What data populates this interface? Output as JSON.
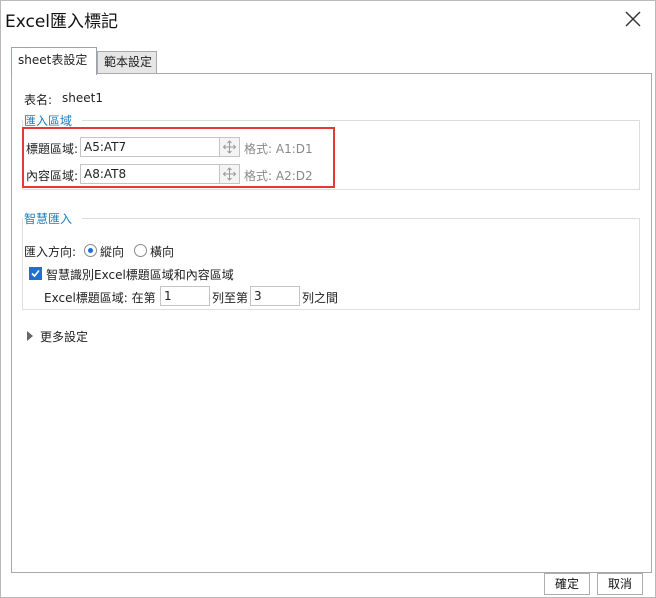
{
  "window": {
    "title": "Excel匯入標記"
  },
  "tabs": [
    {
      "label": "sheet表設定"
    },
    {
      "label": "範本設定"
    }
  ],
  "sheet": {
    "label": "表名:",
    "name": "sheet1"
  },
  "import_area": {
    "section_title": "匯入區域",
    "header": {
      "label": "標題區域:",
      "value": "A5:AT7",
      "hint": "格式: A1:D1"
    },
    "content": {
      "label": "內容區域:",
      "value": "A8:AT8",
      "hint": "格式: A2:D2"
    }
  },
  "smart_import": {
    "section_title": "智慧匯入",
    "direction_label": "匯入方向:",
    "direction_options": [
      {
        "label": "縱向",
        "selected": true
      },
      {
        "label": "橫向",
        "selected": false
      }
    ],
    "smart_checkbox_label": "智慧識別Excel標題區域和內容區域",
    "smart_checkbox_checked": true,
    "range_label": "Excel標題區域: 在第",
    "range_start": "1",
    "range_mid": "列至第",
    "range_end": "3",
    "range_suffix": "列之間"
  },
  "more_settings": {
    "label": "更多設定"
  },
  "footer": {
    "ok_label": "確定",
    "cancel_label": "取消"
  },
  "colors": {
    "accent": "#1d7fbf",
    "highlight": "#e53935",
    "check": "#1e6fd0"
  }
}
